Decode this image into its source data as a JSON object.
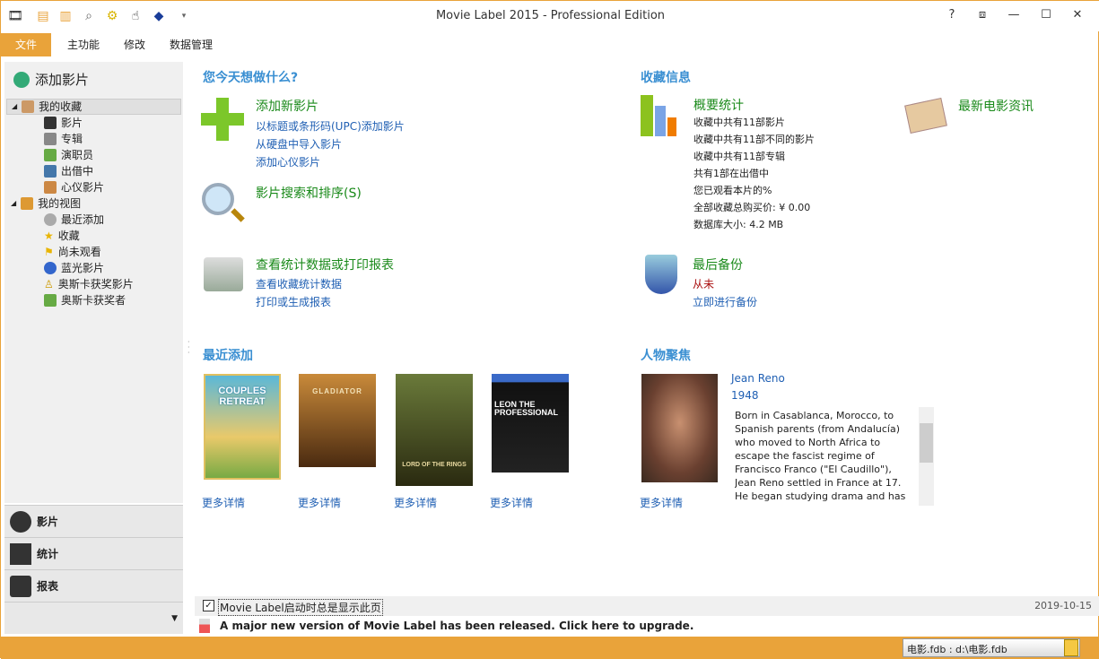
{
  "window": {
    "title": "Movie Label 2015 - Professional Edition",
    "controls": [
      "?",
      "⧈",
      "—",
      "☐",
      "✕"
    ]
  },
  "quick_access": [
    "app-icon",
    "add-icon",
    "save-icon",
    "search-icon",
    "settings-icon",
    "pointer-icon",
    "info-icon",
    "dropdown-icon"
  ],
  "menu": {
    "items": [
      "文件",
      "主功能",
      "修改",
      "数据管理"
    ]
  },
  "sidebar": {
    "add_movie": "添加影片",
    "collection": {
      "label": "我的收藏",
      "items": [
        "影片",
        "专辑",
        "演职员",
        "出借中",
        "心仪影片"
      ]
    },
    "views": {
      "label": "我的视图",
      "items": [
        "最近添加",
        "收藏",
        "尚未观看",
        "蓝光影片",
        "奥斯卡获奖影片",
        "奥斯卡获奖者"
      ]
    },
    "nav": [
      "影片",
      "统计",
      "报表"
    ]
  },
  "main": {
    "todo_title": "您今天想做什么?",
    "add": {
      "title": "添加新影片",
      "links": [
        "以标题或条形码(UPC)添加影片",
        "从硬盘中导入影片",
        "添加心仪影片"
      ]
    },
    "search": {
      "title": "影片搜索和排序(S)"
    },
    "report": {
      "title": "查看统计数据或打印报表",
      "links": [
        "查看收藏统计数据",
        "打印或生成报表"
      ]
    },
    "info_title": "收藏信息",
    "stats": {
      "title": "概要统计",
      "lines": [
        "收藏中共有11部影片",
        "收藏中共有11部不同的影片",
        "收藏中共有11部专辑",
        "共有1部在出借中",
        "您已观看本片的%",
        "全部收藏总购买价: ¥ 0.00",
        "数据库大小: 4.2 MB"
      ]
    },
    "news": "最新电影资讯",
    "backup": {
      "title": "最后备份",
      "status": "从未",
      "link": "立即进行备份"
    },
    "recent_title": "最近添加",
    "posters": [
      {
        "title": "COUPLES RETREAT",
        "more": "更多详情"
      },
      {
        "title": "GLADIATOR",
        "more": "更多详情"
      },
      {
        "title": "LORD OF THE RINGS",
        "more": "更多详情"
      },
      {
        "title": "LEON THE PROFESSIONAL",
        "more": "更多详情"
      }
    ],
    "person_title": "人物聚焦",
    "person": {
      "name": "Jean Reno",
      "year": "1948",
      "bio": "Born in Casablanca, Morocco, to Spanish parents (from Andalucía) who moved to North Africa to escape the fascist regime of Francisco Franco (\"El Caudillo\"), Jean Reno settled in France at 17. He began studying drama and has credits in",
      "more": "更多详情"
    }
  },
  "footer": {
    "checkbox_label": "Movie Label启动时总是显示此页",
    "checked": true,
    "date": "2019-10-15",
    "upgrade": "A major new version of Movie Label has been released. Click here to upgrade.",
    "db": "电影.fdb : d:\\电影.fdb"
  },
  "colors": {
    "accent": "#e9a33a",
    "heading": "#3a8fd2",
    "green": "#1a8a1a",
    "link": "#1f5fb3"
  }
}
